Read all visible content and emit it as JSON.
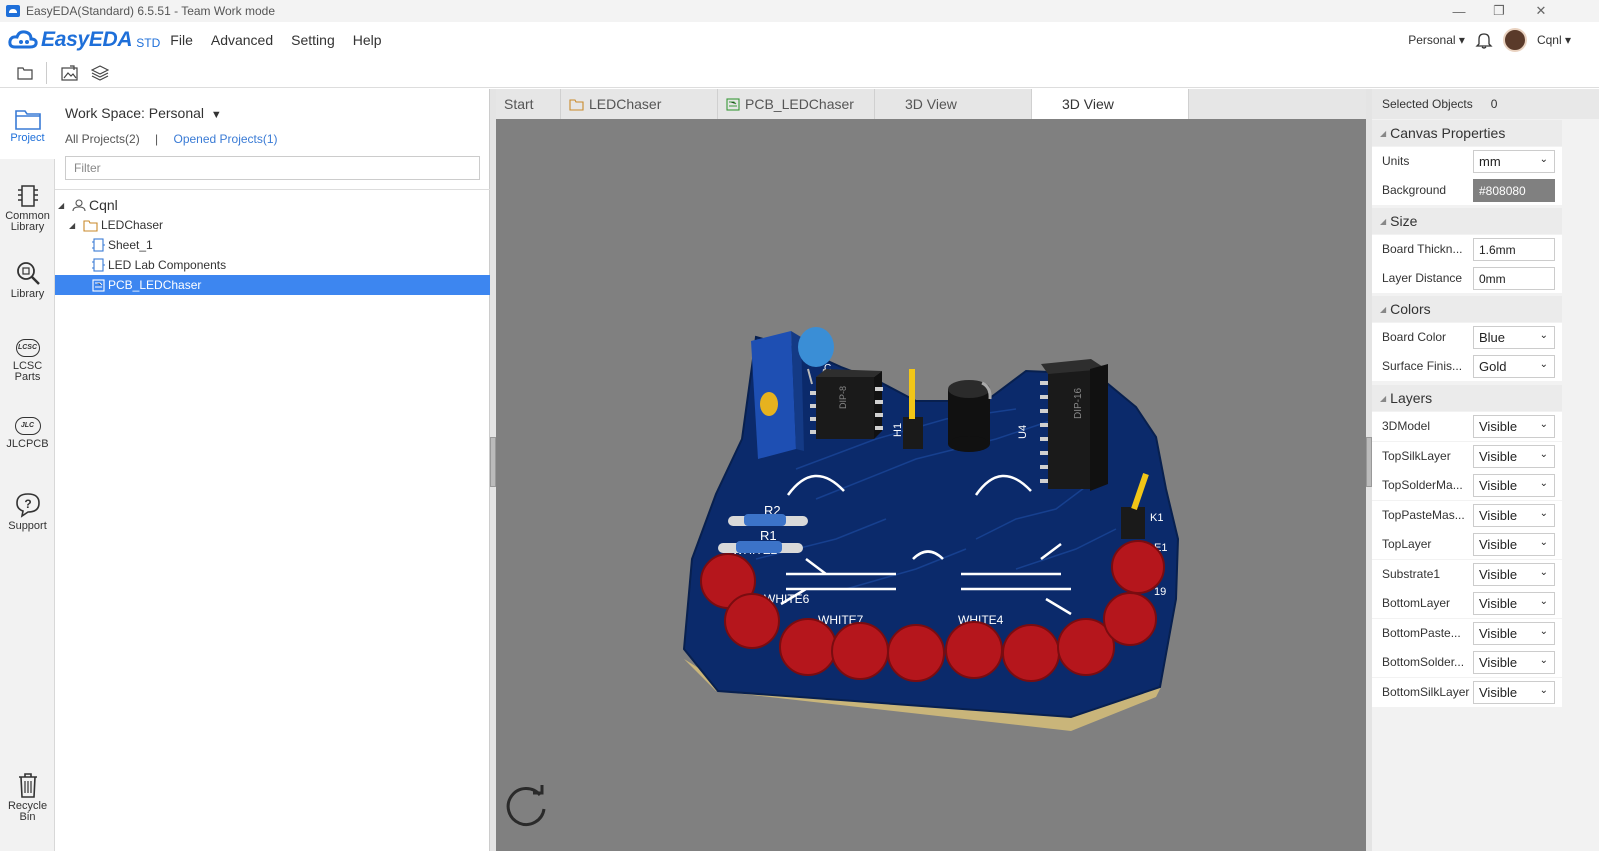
{
  "window": {
    "title": "EasyEDA(Standard) 6.5.51 - Team Work mode"
  },
  "menubar": {
    "logo_text": "EasyEDA",
    "logo_suffix": "STD",
    "items": [
      "File",
      "Advanced",
      "Setting",
      "Help"
    ],
    "workspace": "Personal",
    "user": "Cqnl"
  },
  "leftbar": {
    "items": [
      {
        "label": "Project",
        "icon": "project-icon"
      },
      {
        "label": "Common Library",
        "icon": "common-library-icon"
      },
      {
        "label": "Library",
        "icon": "library-icon"
      },
      {
        "label": "LCSC Parts",
        "icon": "lcsc-icon"
      },
      {
        "label": "JLCPCB",
        "icon": "jlcpcb-icon"
      },
      {
        "label": "Support",
        "icon": "support-icon"
      },
      {
        "label": "Recycle Bin",
        "icon": "recycle-bin-icon"
      }
    ],
    "lcsc_logo": "LCSC",
    "jlc_logo": "JLC"
  },
  "project_panel": {
    "workspace_label": "Work Space: Personal",
    "all_projects": "All Projects(2)",
    "separator": "|",
    "opened_projects": "Opened Projects(1)",
    "filter_placeholder": "Filter",
    "tree": [
      {
        "label": "Cqnl",
        "level": 0,
        "icon": "user-icon"
      },
      {
        "label": "LEDChaser",
        "level": 1,
        "icon": "folder-icon"
      },
      {
        "label": "Sheet_1",
        "level": 2,
        "icon": "schematic-icon"
      },
      {
        "label": "LED Lab Components",
        "level": 2,
        "icon": "schematic-icon"
      },
      {
        "label": "PCB_LEDChaser",
        "level": 2,
        "icon": "pcb-icon",
        "selected": true
      }
    ]
  },
  "doc_tabs": [
    {
      "label": "Start",
      "icon": ""
    },
    {
      "label": "LEDChaser",
      "icon": "folder-icon"
    },
    {
      "label": "PCB_LEDChaser",
      "icon": "pcb-icon"
    },
    {
      "label": "3D View",
      "icon": ""
    },
    {
      "label": "3D View",
      "icon": "",
      "active": true
    }
  ],
  "board_silk": {
    "r2": "R2",
    "r1": "R1",
    "white2": "WHITE2",
    "white6": "WHITE6",
    "white7": "WHITE7",
    "white4": "WHITE4",
    "dip8": "DIP-8",
    "dip16": "DIP-16",
    "u4": "U4",
    "h1": "H1",
    "c": "C",
    "k1": "K1",
    "e1": "E1",
    "n9": "19"
  },
  "properties": {
    "selected_label": "Selected Objects",
    "selected_count": "0",
    "sections": {
      "canvas": "Canvas Properties",
      "size": "Size",
      "colors": "Colors",
      "layers": "Layers"
    },
    "canvas_rows": [
      {
        "label": "Units",
        "value": "mm"
      },
      {
        "label": "Background",
        "value": "#808080"
      }
    ],
    "size_rows": [
      {
        "label": "Board Thickn...",
        "value": "1.6mm"
      },
      {
        "label": "Layer Distance",
        "value": "0mm"
      }
    ],
    "color_rows": [
      {
        "label": "Board Color",
        "value": "Blue"
      },
      {
        "label": "Surface Finis...",
        "value": "Gold"
      }
    ],
    "layer_rows": [
      {
        "label": "3DModel",
        "value": "Visible"
      },
      {
        "label": "TopSilkLayer",
        "value": "Visible"
      },
      {
        "label": "TopSolderMa...",
        "value": "Visible"
      },
      {
        "label": "TopPasteMas...",
        "value": "Visible"
      },
      {
        "label": "TopLayer",
        "value": "Visible"
      },
      {
        "label": "Substrate1",
        "value": "Visible"
      },
      {
        "label": "BottomLayer",
        "value": "Visible"
      },
      {
        "label": "BottomPaste...",
        "value": "Visible"
      },
      {
        "label": "BottomSolder...",
        "value": "Visible"
      },
      {
        "label": "BottomSilkLayer",
        "value": "Visible"
      }
    ]
  },
  "colors": {
    "accent": "#1e6fd9",
    "canvas_bg": "#808080",
    "board": "#0b2a6b",
    "led": "#c0151b",
    "selected_row": "#3d86f0"
  }
}
